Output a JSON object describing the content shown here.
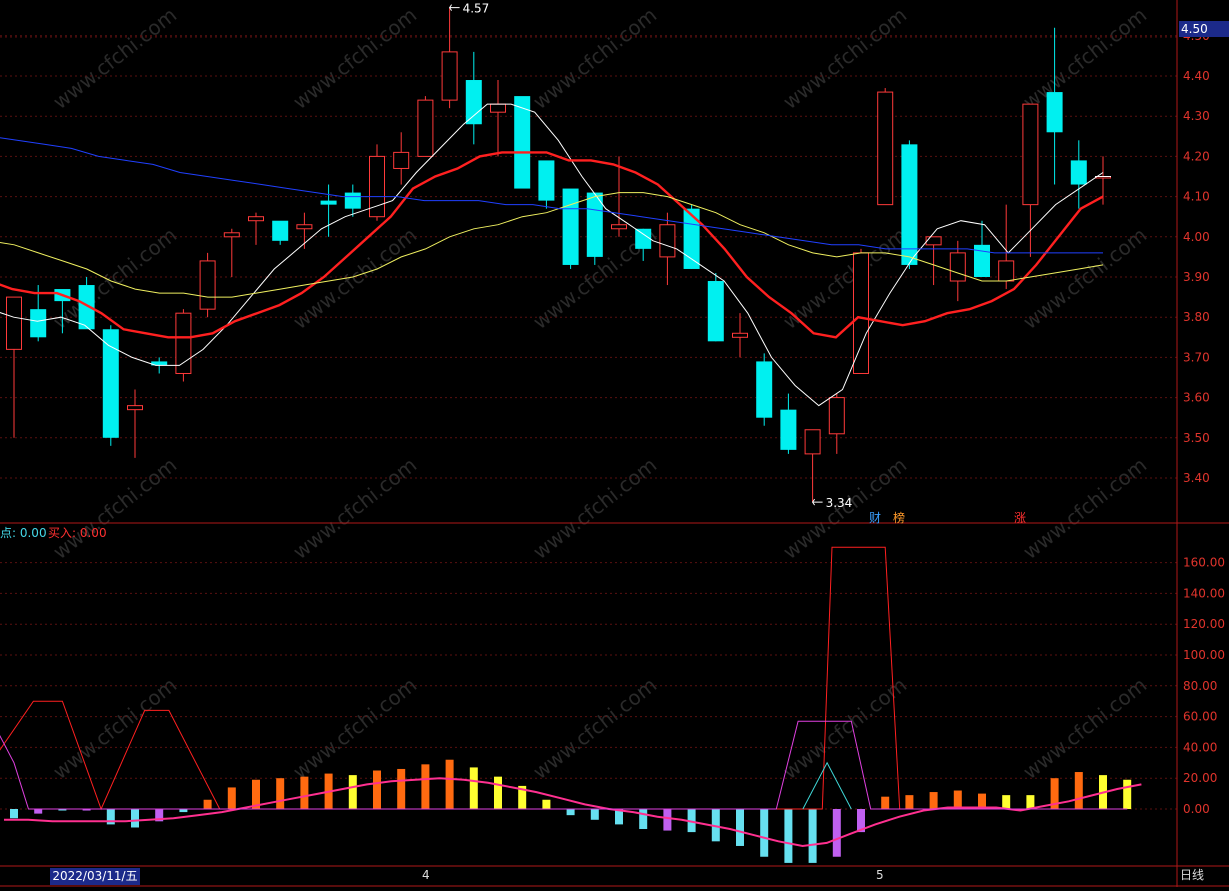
{
  "chart_data": [
    {
      "type": "candlestick",
      "ylim": [
        3.22,
        4.62
      ],
      "y_ticks": [
        "4.50",
        "4.40",
        "4.30",
        "4.20",
        "4.10",
        "4.00",
        "3.90",
        "3.80",
        "3.70",
        "3.60",
        "3.50",
        "3.40"
      ],
      "current_price_label": "4.50",
      "high_marker": "4.57",
      "low_marker": "3.34",
      "event_flags": [
        {
          "label": "财",
          "color": "#3aa0ff",
          "index": 35
        },
        {
          "label": "榜",
          "color": "#ff9a2a",
          "index": 36
        },
        {
          "label": "涨",
          "color": "#ff3030",
          "index": 41
        }
      ],
      "candles": [
        [
          3.72,
          3.85,
          3.5,
          3.85
        ],
        [
          3.82,
          3.88,
          3.74,
          3.75
        ],
        [
          3.87,
          3.86,
          3.76,
          3.84
        ],
        [
          3.88,
          3.9,
          3.78,
          3.77
        ],
        [
          3.77,
          3.78,
          3.48,
          3.5
        ],
        [
          3.57,
          3.62,
          3.45,
          3.58
        ],
        [
          3.69,
          3.7,
          3.66,
          3.68
        ],
        [
          3.66,
          3.82,
          3.64,
          3.81
        ],
        [
          3.82,
          3.96,
          3.8,
          3.94
        ],
        [
          4.0,
          4.02,
          3.9,
          4.01
        ],
        [
          4.04,
          4.06,
          3.98,
          4.05
        ],
        [
          4.04,
          4.02,
          3.98,
          3.99
        ],
        [
          4.02,
          4.06,
          3.97,
          4.03
        ],
        [
          4.09,
          4.13,
          4.0,
          4.08
        ],
        [
          4.11,
          4.13,
          4.05,
          4.07
        ],
        [
          4.05,
          4.23,
          4.04,
          4.2
        ],
        [
          4.17,
          4.26,
          4.13,
          4.21
        ],
        [
          4.2,
          4.35,
          4.2,
          4.34
        ],
        [
          4.34,
          4.57,
          4.32,
          4.46
        ],
        [
          4.39,
          4.46,
          4.23,
          4.28
        ],
        [
          4.31,
          4.39,
          4.2,
          4.33
        ],
        [
          4.35,
          4.32,
          4.15,
          4.12
        ],
        [
          4.19,
          4.18,
          4.07,
          4.09
        ],
        [
          4.12,
          4.1,
          3.92,
          3.93
        ],
        [
          4.11,
          4.11,
          3.93,
          3.95
        ],
        [
          4.02,
          4.2,
          4.0,
          4.03
        ],
        [
          4.02,
          4.02,
          3.94,
          3.97
        ],
        [
          3.95,
          4.06,
          3.88,
          4.03
        ],
        [
          4.07,
          4.08,
          3.92,
          3.92
        ],
        [
          3.89,
          3.91,
          3.74,
          3.74
        ],
        [
          3.75,
          3.81,
          3.7,
          3.76
        ],
        [
          3.69,
          3.71,
          3.53,
          3.55
        ],
        [
          3.57,
          3.61,
          3.46,
          3.47
        ],
        [
          3.46,
          3.51,
          3.34,
          3.52
        ],
        [
          3.51,
          3.61,
          3.46,
          3.6
        ],
        [
          3.66,
          3.97,
          3.66,
          3.96
        ],
        [
          4.08,
          4.37,
          4.08,
          4.36
        ],
        [
          4.23,
          4.24,
          3.92,
          3.93
        ],
        [
          3.98,
          4.0,
          3.88,
          4.0
        ],
        [
          3.89,
          3.99,
          3.84,
          3.96
        ],
        [
          3.98,
          4.04,
          3.9,
          3.9
        ],
        [
          3.89,
          4.08,
          3.87,
          3.94
        ],
        [
          4.08,
          4.33,
          3.95,
          4.33
        ],
        [
          4.36,
          4.52,
          4.13,
          4.26
        ],
        [
          4.19,
          4.24,
          4.07,
          4.13
        ],
        [
          4.15,
          4.2,
          4.08,
          4.15
        ]
      ],
      "series": [
        {
          "label": "MA5",
          "color": "#ffffff",
          "values": [
            3.82,
            3.8,
            3.79,
            3.8,
            3.78,
            3.73,
            3.7,
            3.68,
            3.68,
            3.72,
            3.78,
            3.85,
            3.92,
            3.97,
            4.02,
            4.05,
            4.07,
            4.09,
            4.16,
            4.22,
            4.28,
            4.33,
            4.33,
            4.31,
            4.24,
            4.15,
            4.07,
            4.03,
            3.99,
            3.97,
            3.93,
            3.89,
            3.81,
            3.7,
            3.63,
            3.58,
            3.62,
            3.76,
            3.86,
            3.95,
            4.02,
            4.04,
            4.03,
            3.96,
            4.02,
            4.08,
            4.12,
            4.16
          ]
        },
        {
          "label": "MA10",
          "color": "#ff2020",
          "values": [
            3.89,
            3.87,
            3.86,
            3.86,
            3.84,
            3.81,
            3.77,
            3.76,
            3.75,
            3.75,
            3.76,
            3.79,
            3.81,
            3.83,
            3.86,
            3.9,
            3.95,
            4.0,
            4.05,
            4.12,
            4.15,
            4.17,
            4.2,
            4.21,
            4.21,
            4.21,
            4.19,
            4.19,
            4.18,
            4.16,
            4.13,
            4.08,
            4.03,
            3.97,
            3.9,
            3.85,
            3.81,
            3.76,
            3.75,
            3.8,
            3.79,
            3.78,
            3.79,
            3.81,
            3.82,
            3.84,
            3.87,
            3.93,
            4.0,
            4.07,
            4.1
          ]
        },
        {
          "label": "MA20",
          "color": "#f0f060",
          "values": [
            3.99,
            3.98,
            3.96,
            3.94,
            3.92,
            3.89,
            3.87,
            3.86,
            3.86,
            3.85,
            3.85,
            3.86,
            3.87,
            3.88,
            3.89,
            3.9,
            3.92,
            3.95,
            3.97,
            4.0,
            4.02,
            4.03,
            4.05,
            4.06,
            4.08,
            4.1,
            4.11,
            4.11,
            4.1,
            4.08,
            4.06,
            4.03,
            4.01,
            3.98,
            3.96,
            3.95,
            3.96,
            3.96,
            3.95,
            3.93,
            3.91,
            3.89,
            3.89,
            3.9,
            3.91,
            3.92,
            3.93
          ]
        },
        {
          "label": "MA60",
          "color": "#2040ff",
          "values": [
            4.25,
            4.24,
            4.23,
            4.22,
            4.2,
            4.19,
            4.18,
            4.16,
            4.15,
            4.14,
            4.13,
            4.12,
            4.11,
            4.1,
            4.1,
            4.1,
            4.09,
            4.09,
            4.09,
            4.08,
            4.08,
            4.07,
            4.07,
            4.06,
            4.05,
            4.04,
            4.03,
            4.02,
            4.01,
            4.0,
            3.99,
            3.98,
            3.98,
            3.97,
            3.97,
            3.97,
            3.97,
            3.96,
            3.96,
            3.96,
            3.96,
            3.96
          ]
        }
      ]
    },
    {
      "type": "bar",
      "ylim": [
        -15,
        178
      ],
      "y_ticks": [
        "160.00",
        "140.00",
        "120.00",
        "100.00",
        "80.00",
        "60.00",
        "40.00",
        "20.00",
        "0.00"
      ],
      "indicator_labels": [
        {
          "text": "点: 0.00",
          "color": "#44d8e8"
        },
        {
          "text": "买入: 0.00",
          "color": "#ff3030"
        }
      ],
      "bars": [
        {
          "v": -6,
          "c": "#66e0f0"
        },
        {
          "v": -3,
          "c": "#c060f0"
        },
        {
          "v": -1,
          "c": "#66e0f0"
        },
        {
          "v": -1,
          "c": "#c060f0"
        },
        {
          "v": -10,
          "c": "#66e0f0"
        },
        {
          "v": -12,
          "c": "#66e0f0"
        },
        {
          "v": -8,
          "c": "#c060f0"
        },
        {
          "v": -2,
          "c": "#66e0f0"
        },
        {
          "v": 6,
          "c": "#ff6a10"
        },
        {
          "v": 14,
          "c": "#ff6a10"
        },
        {
          "v": 19,
          "c": "#ff6a10"
        },
        {
          "v": 20,
          "c": "#ff6a10"
        },
        {
          "v": 21,
          "c": "#ff6a10"
        },
        {
          "v": 23,
          "c": "#ff6a10"
        },
        {
          "v": 22,
          "c": "#ffff30"
        },
        {
          "v": 25,
          "c": "#ff6a10"
        },
        {
          "v": 26,
          "c": "#ff6a10"
        },
        {
          "v": 29,
          "c": "#ff6a10"
        },
        {
          "v": 32,
          "c": "#ff6a10"
        },
        {
          "v": 27,
          "c": "#ffff30"
        },
        {
          "v": 21,
          "c": "#ffff30"
        },
        {
          "v": 15,
          "c": "#ffff30"
        },
        {
          "v": 6,
          "c": "#ffff30"
        },
        {
          "v": -4,
          "c": "#66e0f0"
        },
        {
          "v": -7,
          "c": "#66e0f0"
        },
        {
          "v": -10,
          "c": "#66e0f0"
        },
        {
          "v": -13,
          "c": "#66e0f0"
        },
        {
          "v": -14,
          "c": "#c060f0"
        },
        {
          "v": -15,
          "c": "#66e0f0"
        },
        {
          "v": -21,
          "c": "#66e0f0"
        },
        {
          "v": -24,
          "c": "#66e0f0"
        },
        {
          "v": -31,
          "c": "#66e0f0"
        },
        {
          "v": -35,
          "c": "#66e0f0"
        },
        {
          "v": -35,
          "c": "#66e0f0"
        },
        {
          "v": -31,
          "c": "#c060f0"
        },
        {
          "v": -15,
          "c": "#c060f0"
        },
        {
          "v": 8,
          "c": "#ff6a10"
        },
        {
          "v": 9,
          "c": "#ff6a10"
        },
        {
          "v": 11,
          "c": "#ff6a10"
        },
        {
          "v": 12,
          "c": "#ff6a10"
        },
        {
          "v": 10,
          "c": "#ff6a10"
        },
        {
          "v": 9,
          "c": "#ffff30"
        },
        {
          "v": 9,
          "c": "#ffff30"
        },
        {
          "v": 20,
          "c": "#ff6a10"
        },
        {
          "v": 24,
          "c": "#ff6a10"
        },
        {
          "v": 22,
          "c": "#ffff30"
        },
        {
          "v": 19,
          "c": "#ffff30"
        }
      ],
      "series": [
        {
          "label": "",
          "color": "#ff3090",
          "values": [
            -7,
            -7,
            -8,
            -8,
            -8,
            -8,
            -7,
            -6,
            -4,
            -2,
            1,
            4,
            7,
            10,
            13,
            16,
            18,
            19,
            20,
            19,
            17,
            14,
            11,
            7,
            3,
            0,
            -2,
            -5,
            -7,
            -10,
            -13,
            -17,
            -21,
            -24,
            -22,
            -16,
            -10,
            -5,
            -1,
            1,
            1,
            1,
            -1,
            2,
            5,
            9,
            13,
            16
          ]
        },
        {
          "label": "",
          "color": "#ff2020",
          "points": [
            [
              -0.6,
              38
            ],
            [
              0.8,
              70
            ],
            [
              2,
              70
            ],
            [
              3.6,
              0
            ],
            [
              5.4,
              64
            ],
            [
              6.4,
              64
            ],
            [
              8.5,
              0
            ],
            [
              33.4,
              0
            ],
            [
              33.8,
              170
            ],
            [
              36,
              170
            ],
            [
              36.6,
              0
            ],
            [
              46,
              0
            ]
          ]
        },
        {
          "label": "",
          "color": "#e040e0",
          "points": [
            [
              -0.6,
              48
            ],
            [
              0,
              30
            ],
            [
              0.6,
              0
            ],
            [
              31.5,
              0
            ],
            [
              32.4,
              57
            ],
            [
              34.6,
              57
            ],
            [
              35.4,
              0
            ],
            [
              46,
              0
            ]
          ]
        },
        {
          "label": "",
          "color": "#40d8d8",
          "points": [
            [
              32.6,
              0
            ],
            [
              33.6,
              30
            ],
            [
              34.6,
              0
            ]
          ]
        }
      ]
    }
  ],
  "x_labels": {
    "date": "2022/03/11/五",
    "month_4": "4",
    "month_5": "5",
    "period": "日线"
  },
  "watermark": "www.cfchi.com",
  "colors": {
    "background": "#000000",
    "grid": "#5a1010",
    "frame": "#b01818",
    "up": "#ff3a3a",
    "down": "#00f0f0"
  }
}
